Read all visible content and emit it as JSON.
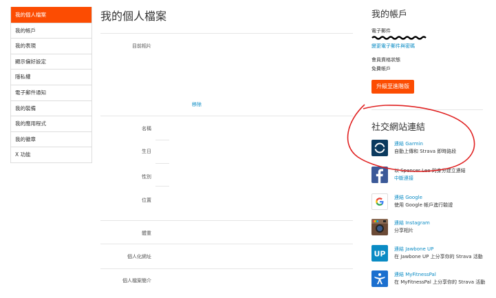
{
  "sidebar": {
    "items": [
      {
        "label": "我的個人檔案",
        "active": true
      },
      {
        "label": "我的帳戶",
        "active": false
      },
      {
        "label": "我的表現",
        "active": false
      },
      {
        "label": "顯示偏好設定",
        "active": false
      },
      {
        "label": "隱私權",
        "active": false
      },
      {
        "label": "電子郵件通知",
        "active": false
      },
      {
        "label": "我的裝備",
        "active": false
      },
      {
        "label": "我的應用程式",
        "active": false
      },
      {
        "label": "我的徽章",
        "active": false
      },
      {
        "label": "X 功能",
        "active": false
      }
    ]
  },
  "main": {
    "title": "我的個人檔案",
    "current_photo_label": "目前相片",
    "remove_link": "移除",
    "fields": {
      "name": "名稱",
      "birthday": "生日",
      "gender": "性別",
      "location": "位置",
      "weight": "體重",
      "custom_url": "個人化網址",
      "bio": "個人檔案簡介"
    }
  },
  "account": {
    "title": "我的帳戶",
    "email_label": "電子郵件",
    "change_link": "變更電子郵件與密碼",
    "membership_label": "會員資格狀態",
    "membership_value": "免費帳戶",
    "upgrade_button": "升級至進階版"
  },
  "social": {
    "title": "社交網站連結",
    "items": [
      {
        "icon": "garmin-icon",
        "head": "連結 Garmin",
        "desc": "自動上傳和 Strava 即時路段"
      },
      {
        "icon": "facebook-icon",
        "head": "以 Spencer Lee 的身分建立連結",
        "desc": "中斷連接"
      },
      {
        "icon": "google-icon",
        "head": "連結 Google",
        "desc": "使用 Google 帳戶進行驗證"
      },
      {
        "icon": "instagram-icon",
        "head": "連結 Instagram",
        "desc": "分享相片"
      },
      {
        "icon": "jawbone-up-icon",
        "head": "連結 Jawbone UP",
        "desc": "在 Jawbone UP 上分享你的 Strava 活動"
      },
      {
        "icon": "myfitnesspal-icon",
        "head": "連結 MyFitnessPal",
        "desc": "在 MyFitnessPal 上分享你的 Strava 活動"
      }
    ]
  },
  "colors": {
    "accent": "#fc4c02",
    "link": "#0a8bc4",
    "annotation": "#e02020",
    "facebook": "#3b5998",
    "jawbone": "#0a8bc4"
  }
}
